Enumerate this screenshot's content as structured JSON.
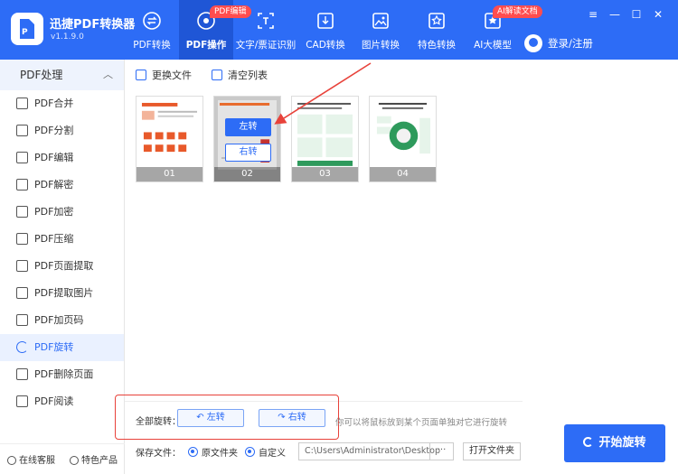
{
  "app": {
    "name": "迅捷PDF转换器",
    "version": "v1.1.9.0"
  },
  "nav": [
    {
      "label": "PDF转换",
      "icon": "pdf-convert-icon"
    },
    {
      "label": "PDF操作",
      "icon": "pdf-operation-icon",
      "active": true,
      "badge": "PDF编辑"
    },
    {
      "label": "文字/票证识别",
      "icon": "text-ocr-icon"
    },
    {
      "label": "CAD转换",
      "icon": "cad-convert-icon"
    },
    {
      "label": "图片转换",
      "icon": "image-convert-icon"
    },
    {
      "label": "特色转换",
      "icon": "special-convert-icon"
    },
    {
      "label": "AI大模型",
      "icon": "ai-model-icon",
      "badge": "AI解读文档"
    }
  ],
  "login": {
    "label": "登录/注册"
  },
  "window_controls": {
    "menu": "≡",
    "minimize": "—",
    "maximize": "☐",
    "close": "✕"
  },
  "sidebar": {
    "title": "PDF处理",
    "items": [
      {
        "label": "PDF合并",
        "icon": "merge-icon"
      },
      {
        "label": "PDF分割",
        "icon": "split-icon"
      },
      {
        "label": "PDF编辑",
        "icon": "edit-icon"
      },
      {
        "label": "PDF解密",
        "icon": "unlock-icon"
      },
      {
        "label": "PDF加密",
        "icon": "shield-icon"
      },
      {
        "label": "PDF压缩",
        "icon": "compress-icon"
      },
      {
        "label": "PDF页面提取",
        "icon": "page-extract-icon"
      },
      {
        "label": "PDF提取图片",
        "icon": "image-extract-icon"
      },
      {
        "label": "PDF加页码",
        "icon": "page-number-icon"
      },
      {
        "label": "PDF旋转",
        "icon": "rotate-icon",
        "active": true
      },
      {
        "label": "PDF删除页面",
        "icon": "delete-page-icon"
      },
      {
        "label": "PDF阅读",
        "icon": "read-icon"
      }
    ],
    "footer": {
      "service": "在线客服",
      "featured": "特色产品"
    }
  },
  "toolbar": {
    "replace_file": "更换文件",
    "clear_list": "清空列表"
  },
  "pages": [
    {
      "num": "01"
    },
    {
      "num": "02",
      "selected": true,
      "rotate_left": "左转",
      "rotate_right": "右转"
    },
    {
      "num": "03"
    },
    {
      "num": "04"
    }
  ],
  "rotate_all": {
    "label": "全部旋转：",
    "left": "左转",
    "right": "右转"
  },
  "hint": "你可以将鼠标放到某个页面单独对它进行旋转",
  "save": {
    "label": "保存文件：",
    "option_source": "原文件夹",
    "option_custom": "自定义",
    "selected": "自定义",
    "path": "C:\\Users\\Administrator\\Desktop",
    "browse": "···",
    "open_folder": "打开文件夹"
  },
  "start_button": "开始旋转",
  "colors": {
    "brand": "#2d6cf6",
    "highlight": "#e8423a"
  }
}
